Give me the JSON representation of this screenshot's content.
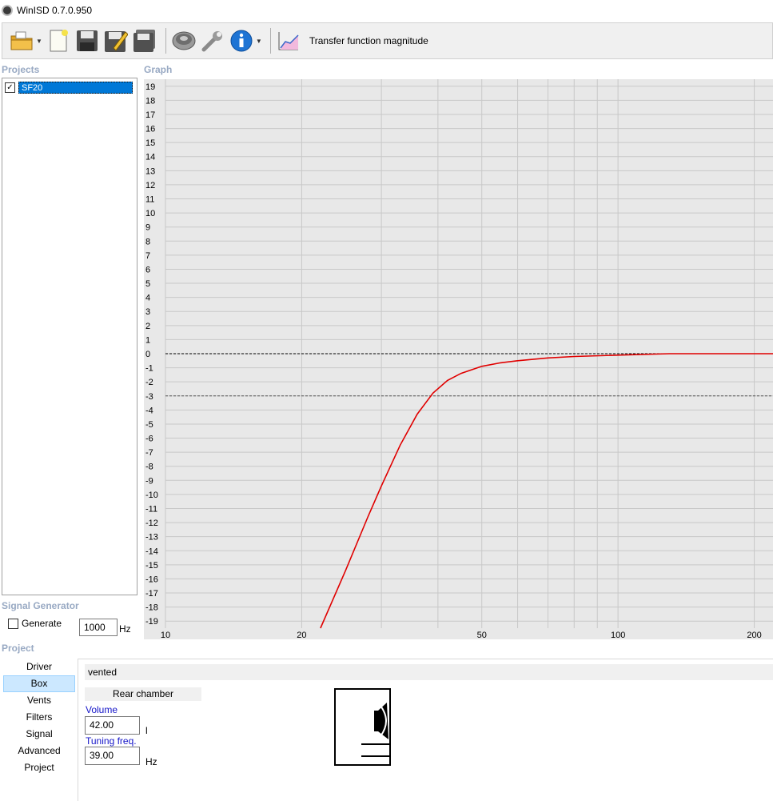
{
  "window": {
    "title": "WinISD 0.7.0.950"
  },
  "toolbar": {
    "buttons": [
      "open-folder-icon",
      "new-project-icon",
      "save-icon",
      "save-as-icon",
      "save-all-icon",
      "driver-editor-icon",
      "options-wrench-icon",
      "info-icon"
    ],
    "graph_type_label": "Transfer function magnitude"
  },
  "sections": {
    "projects": "Projects",
    "graph": "Graph",
    "signal_generator": "Signal Generator",
    "project": "Project"
  },
  "projects": [
    {
      "name": "SF20",
      "checked": true
    }
  ],
  "signal_generator": {
    "generate_label": "Generate",
    "generate_checked": false,
    "frequency": "1000",
    "unit": "Hz"
  },
  "nav": {
    "items": [
      "Driver",
      "Box",
      "Vents",
      "Filters",
      "Signal",
      "Advanced",
      "Project"
    ],
    "active": "Box"
  },
  "box": {
    "type": "vented",
    "rear_chamber_label": "Rear chamber",
    "volume_label": "Volume",
    "volume_value": "42.00",
    "volume_unit": "l",
    "tuning_label": "Tuning freq.",
    "tuning_value": "39.00",
    "tuning_unit": "Hz"
  },
  "colors": {
    "curve": "#e00000",
    "grid": "#c8c8c8",
    "plot_bg": "#e8e8e8",
    "section_label": "#98a9c3"
  },
  "chart_data": {
    "type": "line",
    "title": "",
    "xlabel": "",
    "ylabel": "",
    "x_scale": "log",
    "xlim": [
      10,
      220
    ],
    "ylim": [
      -19.5,
      19.5
    ],
    "x_tick_labels": [
      "10",
      "20",
      "50",
      "100",
      "200"
    ],
    "x_tick_values": [
      10,
      20,
      50,
      100,
      200
    ],
    "y_tick_values": [
      19,
      18,
      17,
      16,
      15,
      14,
      13,
      12,
      11,
      10,
      9,
      8,
      7,
      6,
      5,
      4,
      3,
      2,
      1,
      0,
      -1,
      -2,
      -3,
      -4,
      -5,
      -6,
      -7,
      -8,
      -9,
      -10,
      -11,
      -12,
      -13,
      -14,
      -15,
      -16,
      -17,
      -18,
      -19
    ],
    "reference_lines": [
      {
        "y": 0,
        "style": "dashed"
      },
      {
        "y": -3,
        "style": "dashed"
      }
    ],
    "series": [
      {
        "color": "#e00000",
        "x": [
          22,
          25,
          28,
          30,
          33,
          36,
          39,
          42,
          45,
          50,
          55,
          60,
          70,
          80,
          100,
          130,
          160,
          220
        ],
        "y": [
          -20,
          -15.4,
          -11.6,
          -9.4,
          -6.5,
          -4.3,
          -2.8,
          -1.9,
          -1.4,
          -0.9,
          -0.65,
          -0.5,
          -0.3,
          -0.2,
          -0.1,
          0,
          0,
          0
        ]
      }
    ]
  }
}
